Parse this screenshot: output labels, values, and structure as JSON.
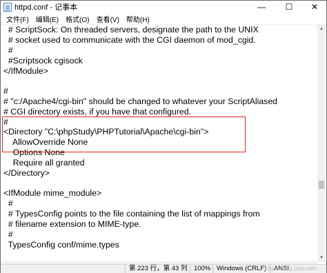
{
  "window": {
    "title": "httpd.conf - 记事本",
    "controls": {
      "minimize": "—",
      "maximize": "☐",
      "close": "✕"
    }
  },
  "menu": [
    "文件(F)",
    "编辑(E)",
    "格式(O)",
    "查看(V)",
    "帮助(H)"
  ],
  "editor": {
    "lines": [
      "  # ScriptSock: On threaded servers, designate the path to the UNIX",
      "  # socket used to communicate with the CGI daemon of mod_cgid.",
      "  #",
      "  #Scriptsock cgisock",
      "</IfModule>",
      "",
      "#",
      "# \"c:/Apache4/cgi-bin\" should be changed to whatever your ScriptAliased",
      "# CGI directory exists, if you have that configured.",
      "#",
      "<Directory \"C:\\phpStudy\\PHPTutorial\\Apache\\cgi-bin\">",
      "    AllowOverride None",
      "    Options None",
      "    Require all granted",
      "</Directory>",
      "",
      "<IfModule mime_module>",
      "  #",
      "  # TypesConfig points to the file containing the list of mappings from",
      "  # filename extension to MIME-type.",
      "  #",
      "  TypesConfig conf/mime.types",
      "",
      ""
    ],
    "highlight_color": "#e0281e"
  },
  "status": {
    "position": "第 223 行，第 43 列",
    "zoom": "100%",
    "line_ending": "Windows (CRLF)",
    "encoding": "ANSI",
    "watermark": "https://blog.csdn.net/..."
  }
}
